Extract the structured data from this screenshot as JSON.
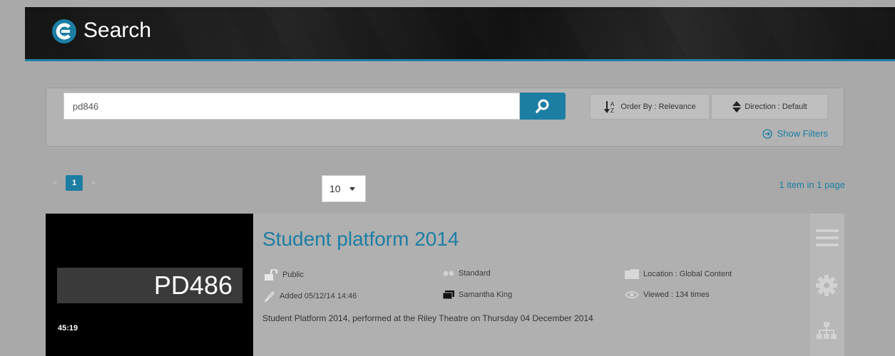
{
  "header": {
    "title": "Search"
  },
  "search": {
    "value": "pd846",
    "order_label": "Order By : Relevance",
    "direction_label": "Direction : Default",
    "show_filters": "Show Filters"
  },
  "pagination": {
    "current_page": "1",
    "per_page": "10",
    "prev_arrow": "«",
    "next_arrow": "»",
    "summary": "1 item in 1 page"
  },
  "result": {
    "thumbnail_label": "PD486",
    "duration": "45:19",
    "title": "Student platform 2014",
    "visibility": "Public",
    "quality": "Standard",
    "location": "Location : Global Content",
    "added": "Added 05/12/14 14:46",
    "owner": "Samantha King",
    "views": "Viewed : 134 times",
    "description": "Student Platform 2014, performed at the Riley Theatre on Thursday 04 December 2014"
  },
  "colors": {
    "accent": "#1d7ea3",
    "background": "#a9a9a9"
  }
}
